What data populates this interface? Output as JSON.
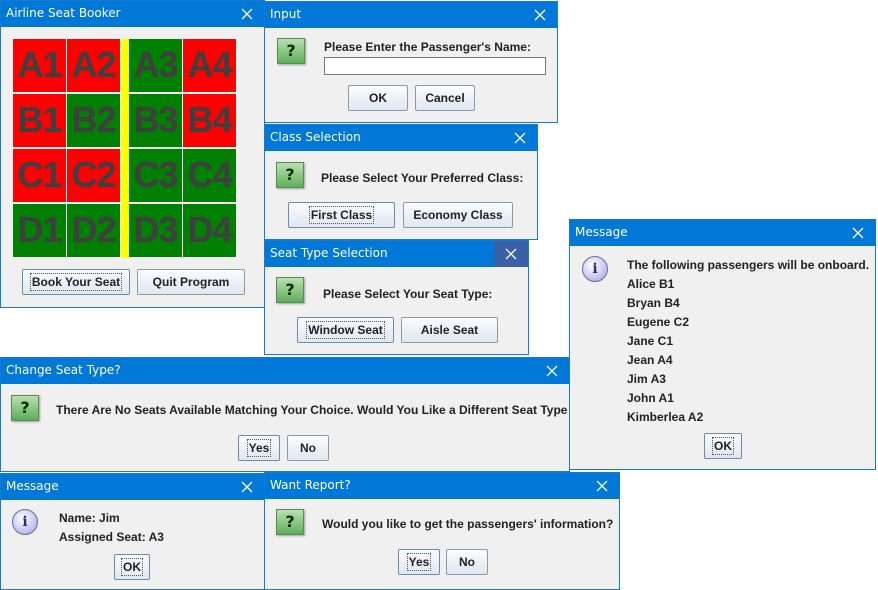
{
  "booker": {
    "title": "Airline Seat Booker",
    "seats": [
      {
        "label": "A1",
        "color": "#ff0000"
      },
      {
        "label": "A2",
        "color": "#ff0000"
      },
      {
        "label": "A3",
        "color": "#008000"
      },
      {
        "label": "A4",
        "color": "#ff0000"
      },
      {
        "label": "B1",
        "color": "#ff0000"
      },
      {
        "label": "B2",
        "color": "#008000"
      },
      {
        "label": "B3",
        "color": "#008000"
      },
      {
        "label": "B4",
        "color": "#ff0000"
      },
      {
        "label": "C1",
        "color": "#ff0000"
      },
      {
        "label": "C2",
        "color": "#ff0000"
      },
      {
        "label": "C3",
        "color": "#008000"
      },
      {
        "label": "C4",
        "color": "#008000"
      },
      {
        "label": "D1",
        "color": "#008000"
      },
      {
        "label": "D2",
        "color": "#008000"
      },
      {
        "label": "D3",
        "color": "#008000"
      },
      {
        "label": "D4",
        "color": "#008000"
      }
    ],
    "aisle_color": "#ffff00",
    "book_label": "Book Your Seat",
    "quit_label": "Quit Program"
  },
  "input_dialog": {
    "title": "Input",
    "prompt": "Please Enter the Passenger's Name:",
    "value": "",
    "ok_label": "OK",
    "cancel_label": "Cancel"
  },
  "class_dialog": {
    "title": "Class Selection",
    "prompt": "Please Select Your Preferred Class:",
    "first_label": "First Class",
    "economy_label": "Economy Class"
  },
  "seat_type_dialog": {
    "title": "Seat Type Selection",
    "prompt": "Please Select Your Seat Type:",
    "window_label": "Window Seat",
    "aisle_label": "Aisle Seat"
  },
  "change_dialog": {
    "title": "Change Seat Type?",
    "prompt": "There Are No Seats Available Matching Your Choice. Would You Like a Different Seat Type",
    "yes_label": "Yes",
    "no_label": "No"
  },
  "message_assigned": {
    "title": "Message",
    "line1": "Name: Jim",
    "line2": "Assigned Seat: A3",
    "ok_label": "OK"
  },
  "report_dialog": {
    "title": "Want Report?",
    "prompt": "Would you like to get the passengers' information?",
    "yes_label": "Yes",
    "no_label": "No"
  },
  "message_onboard": {
    "title": "Message",
    "heading": "The following passengers will be onboard.",
    "passengers": [
      "Alice B1",
      "Bryan B4",
      "Eugene C2",
      "Jane C1",
      "Jean A4",
      "Jim A3",
      "John A1",
      "Kimberlea A2"
    ],
    "ok_label": "OK"
  },
  "icons": {
    "question": "?",
    "info": "i",
    "close": "close-icon"
  }
}
